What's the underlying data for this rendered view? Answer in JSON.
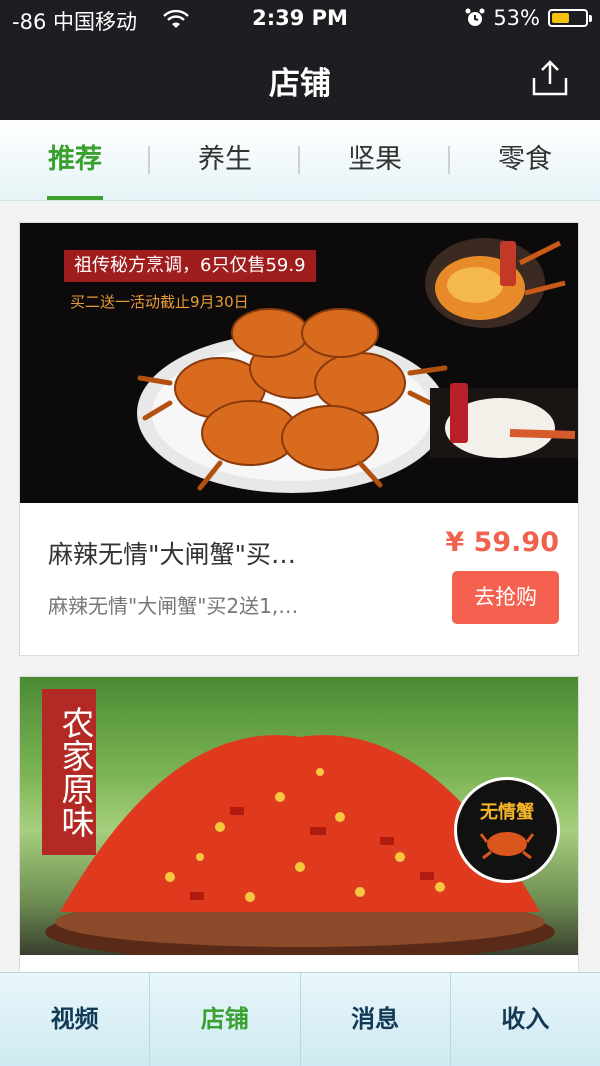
{
  "status_bar": {
    "carrier": "-86 中国移动",
    "time": "2:39 PM",
    "battery": "53%",
    "battery_level": 0.53,
    "icons": [
      "wifi-icon",
      "alarm-icon",
      "battery-icon"
    ]
  },
  "header": {
    "title": "店铺",
    "share_icon": "share-icon"
  },
  "tabs": [
    {
      "label": "推荐",
      "active": true
    },
    {
      "label": "养生",
      "active": false
    },
    {
      "label": "坚果",
      "active": false
    },
    {
      "label": "零食",
      "active": false
    }
  ],
  "products": [
    {
      "banner_title": "祖传秘方烹调，6只仅售59.9",
      "banner_sub": "买二送一活动截止9月30日",
      "name": "麻辣无情\"大闸蟹\"买…",
      "desc": "麻辣无情\"大闸蟹\"买2送1,…",
      "price": "¥ 59.90",
      "buy_label": "去抢购"
    },
    {
      "label": "农家原味",
      "badge": "无情蟹"
    }
  ],
  "bottom_nav": [
    {
      "label": "视频",
      "active": false
    },
    {
      "label": "店铺",
      "active": true
    },
    {
      "label": "消息",
      "active": false
    },
    {
      "label": "收入",
      "active": false
    }
  ],
  "colors": {
    "accent": "#3aa02f",
    "price": "#f0624d",
    "buy_button": "#f4614e",
    "header_bg": "#1c1e22"
  }
}
